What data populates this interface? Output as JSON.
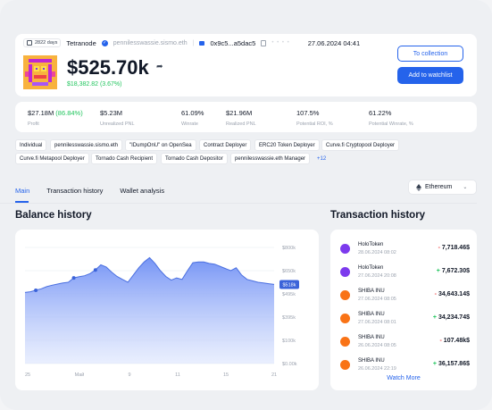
{
  "header": {
    "days_badge": "2822 days",
    "user_name": "Tetranode",
    "ens": "pennilesswassie.sismo.eth",
    "address": "0x9c5...a5dac5",
    "timestamp": "27.06.2024 04:41",
    "balance": "$525.70k",
    "balance_change": "$18,382.82 (3.67%)",
    "btn_collection": "To collection",
    "btn_watchlist": "Add to watchlist"
  },
  "stats": [
    {
      "value": "$27.18M",
      "value_pos": "(86.84%)",
      "label": "Profit"
    },
    {
      "value": "$5.23M",
      "value_pos": "",
      "label": "Unrealized PNL"
    },
    {
      "value": "61.09%",
      "value_pos": "",
      "label": "Winrate"
    },
    {
      "value": "$21.96M",
      "value_pos": "",
      "label": "Realized PNL"
    },
    {
      "value": "107.5%",
      "value_pos": "",
      "label": "Potential ROI, %"
    },
    {
      "value": "61.22%",
      "value_pos": "",
      "label": "Potential Winrate, %"
    }
  ],
  "tags": [
    "Individual",
    "pennilesswassie.sismo.eth",
    "\"IDumpOnU\" on OpenSea",
    "Contract Deployer",
    "ERC20 Token Deployer",
    "Curve.fi Cryptopool Deployer",
    "Curve.fi Metapool Deployer",
    "Tornado Cash Recipient",
    "Tornado Cash Depositor",
    "pennilesswassie.eth Manager",
    "+12"
  ],
  "tabs": [
    "Main",
    "Transaction history",
    "Wallet analysis"
  ],
  "chain": "Ethereum",
  "balance_history_title": "Balance history",
  "transaction_history_title": "Transaction history",
  "watch_more": "Watch More",
  "transactions": [
    {
      "token": "HoloToken",
      "date": "28.06.2024 08:02",
      "sign": "-",
      "amount": "7,718.46$",
      "icon": "holo"
    },
    {
      "token": "HoloToken",
      "date": "27.06.2024 20:08",
      "sign": "+",
      "amount": "7,672.30$",
      "icon": "holo"
    },
    {
      "token": "SHIBA INU",
      "date": "27.06.2024 08:05",
      "sign": "-",
      "amount": "34,643.14$",
      "icon": "shib"
    },
    {
      "token": "SHIBA INU",
      "date": "27.06.2024 08:01",
      "sign": "+",
      "amount": "34,234.74$",
      "icon": "shib"
    },
    {
      "token": "SHIBA INU",
      "date": "26.06.2024 08:05",
      "sign": "-",
      "amount": "107.48k$",
      "icon": "shib"
    },
    {
      "token": "SHIBA INU",
      "date": "26.06.2024 22:19",
      "sign": "+",
      "amount": "36,157.86$",
      "icon": "shib"
    }
  ],
  "chart_data": {
    "type": "area",
    "y_ticks": [
      "$800k",
      "$650k",
      "$495k",
      "$395k",
      "$100k",
      "$0.00k"
    ],
    "x_ticks": [
      "25",
      "Maй",
      "9",
      "11",
      "15",
      "21"
    ],
    "current_label": "$518k",
    "ylim": [
      0,
      800
    ],
    "values": [
      490,
      495,
      505,
      515,
      530,
      540,
      548,
      555,
      560,
      590,
      598,
      605,
      620,
      645,
      680,
      665,
      630,
      600,
      580,
      560,
      610,
      660,
      700,
      730,
      690,
      640,
      600,
      575,
      590,
      580,
      640,
      695,
      700,
      700,
      690,
      685,
      670,
      655,
      640,
      660,
      610,
      580,
      570,
      560,
      555,
      550,
      545
    ],
    "markers": [
      2,
      9,
      13
    ],
    "grid": true,
    "color": "#5b7ff0"
  }
}
